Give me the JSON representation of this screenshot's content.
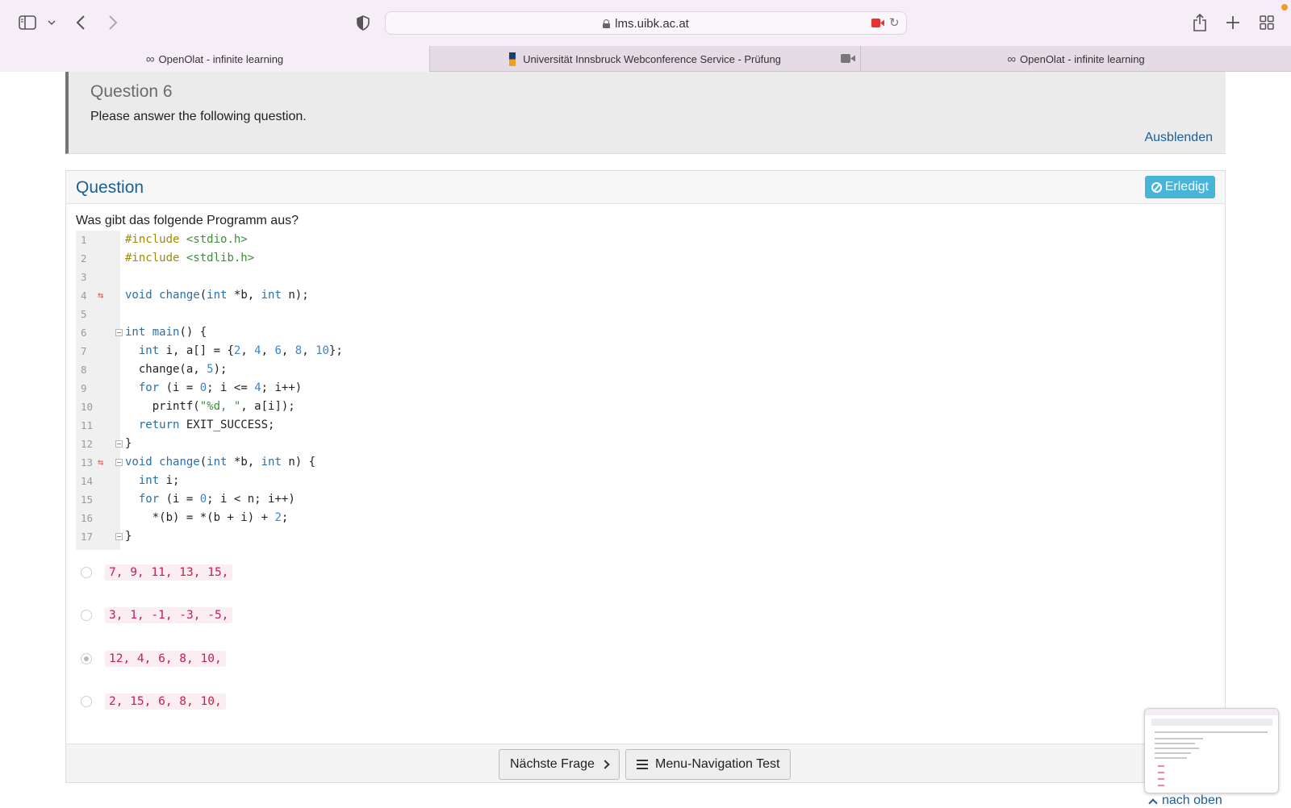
{
  "browser": {
    "address": "lms.uibk.ac.at",
    "tabs": [
      {
        "title": "OpenOlat - infinite learning",
        "active": true
      },
      {
        "title": "Universität Innsbruck Webconference Service - Prüfung",
        "active": false
      },
      {
        "title": "OpenOlat - infinite learning",
        "active": false
      }
    ]
  },
  "info": {
    "title": "Question 6",
    "description": "Please answer the following question.",
    "hide_link": "Ausblenden"
  },
  "question": {
    "header": "Question",
    "done_label": "Erledigt",
    "prompt": "Was gibt das folgende Programm aus?",
    "code_lines": [
      "#include <stdio.h>",
      "#include <stdlib.h>",
      "",
      "void change(int *b, int n);",
      "",
      "int main() {",
      "  int i, a[] = {2, 4, 6, 8, 10};",
      "  change(a, 5);",
      "  for (i = 0; i <= 4; i++)",
      "    printf(\"%d, \", a[i]);",
      "  return EXIT_SUCCESS;",
      "}",
      "void change(int *b, int n) {",
      "  int i;",
      "  for (i = 0; i < n; i++)",
      "    *(b) = *(b + i) + 2;",
      "}"
    ],
    "options": [
      {
        "text": "7, 9, 11, 13, 15,",
        "selected": false
      },
      {
        "text": "3, 1, -1, -3, -5,",
        "selected": false
      },
      {
        "text": "12, 4, 6, 8, 10,",
        "selected": true
      },
      {
        "text": "2, 15, 6, 8, 10,",
        "selected": false
      }
    ]
  },
  "footer": {
    "next_label": "Nächste Frage",
    "menu_label": "Menu-Navigation Test"
  },
  "back_to_top": "nach oben",
  "colors": {
    "accent": "#1b5e96",
    "done_button": "#46b5d8",
    "answer_text": "#c4214d"
  }
}
